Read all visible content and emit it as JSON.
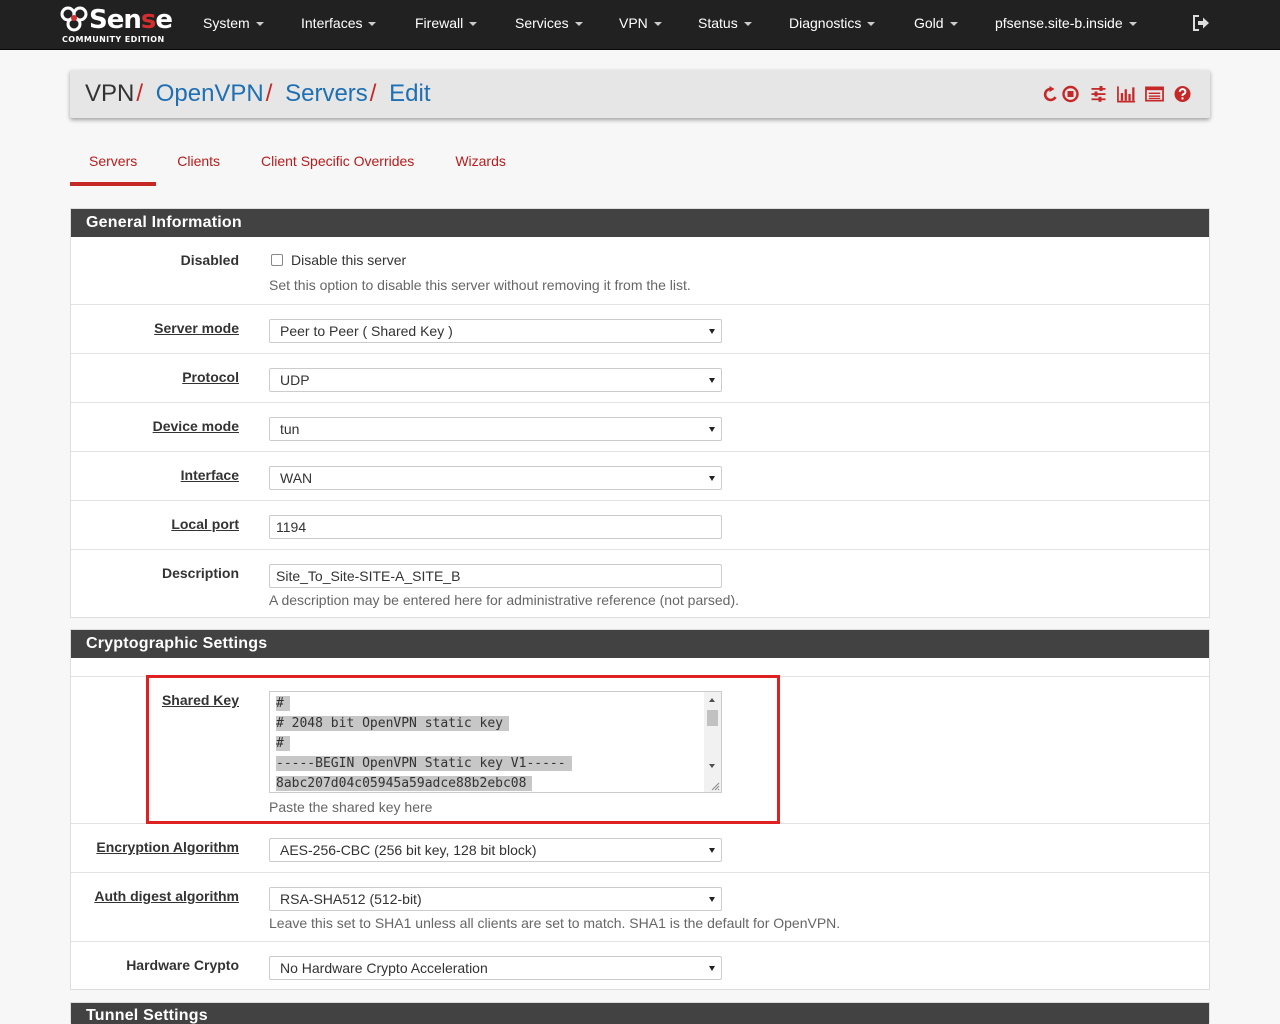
{
  "brand": {
    "name_part1": "Sen",
    "name_part2": "s",
    "name_part3": "e",
    "subtitle": "COMMUNITY EDITION"
  },
  "nav": {
    "items": [
      "System",
      "Interfaces",
      "Firewall",
      "Services",
      "VPN",
      "Status",
      "Diagnostics",
      "Gold",
      "pfsense.site-b.inside"
    ],
    "logout_icon": "sign-out-icon"
  },
  "breadcrumb": {
    "root": "VPN",
    "links": [
      "OpenVPN",
      "Servers",
      "Edit"
    ],
    "separator": "/",
    "icons": [
      "restart-icon",
      "stop-icon",
      "settings-sliders-icon",
      "bar-chart-icon",
      "log-list-icon",
      "help-icon"
    ]
  },
  "tabs": {
    "items": [
      "Servers",
      "Clients",
      "Client Specific Overrides",
      "Wizards"
    ],
    "active": "Servers"
  },
  "general": {
    "title": "General Information",
    "disabled": {
      "label": "Disabled",
      "checkbox_label": "Disable this server",
      "checked": false,
      "help": "Set this option to disable this server without removing it from the list."
    },
    "server_mode": {
      "label": "Server mode",
      "value": "Peer to Peer ( Shared Key )"
    },
    "protocol": {
      "label": "Protocol",
      "value": "UDP"
    },
    "device_mode": {
      "label": "Device mode",
      "value": "tun"
    },
    "interface": {
      "label": "Interface",
      "value": "WAN"
    },
    "local_port": {
      "label": "Local port",
      "value": "1194"
    },
    "description": {
      "label": "Description",
      "value": "Site_To_Site-SITE-A_SITE_B",
      "help": "A description may be entered here for administrative reference (not parsed)."
    }
  },
  "crypto": {
    "title": "Cryptographic Settings",
    "shared_key": {
      "label": "Shared Key",
      "lines": [
        "#",
        "# 2048 bit OpenVPN static key",
        "#",
        "-----BEGIN OpenVPN Static key V1-----",
        "8abc207d04c05945a59adce88b2ebc08"
      ],
      "help": "Paste the shared key here"
    },
    "encryption": {
      "label": "Encryption Algorithm",
      "value": "AES-256-CBC (256 bit key, 128 bit block)"
    },
    "auth_digest": {
      "label": "Auth digest algorithm",
      "value": "RSA-SHA512 (512-bit)",
      "help": "Leave this set to SHA1 unless all clients are set to match. SHA1 is the default for OpenVPN."
    },
    "hw_crypto": {
      "label": "Hardware Crypto",
      "value": "No Hardware Crypto Acceleration"
    }
  },
  "tunnel": {
    "title": "Tunnel Settings"
  },
  "colors": {
    "navbar": "#212121",
    "accent_red": "#c62828",
    "link_blue": "#1e6fb3",
    "panel_heading": "#424242",
    "annotation_box": "#e02121"
  }
}
